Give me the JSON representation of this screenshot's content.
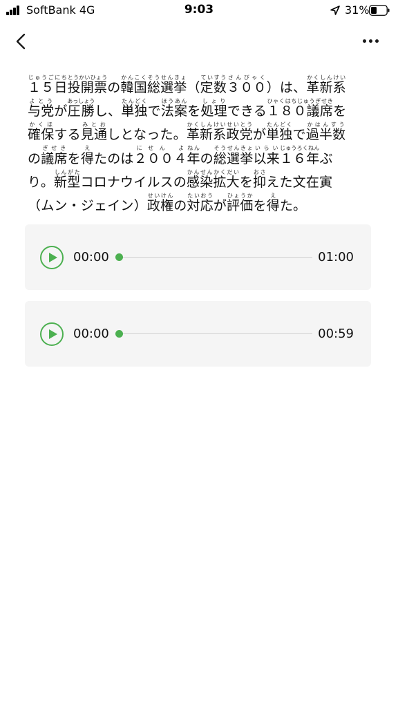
{
  "status_bar": {
    "carrier": "SoftBank  4G",
    "time": "9:03",
    "battery": "31%"
  },
  "nav": {
    "back_icon": "chevron-left-icon",
    "more_icon": "ellipsis-icon"
  },
  "article": {
    "lines": [
      [
        {
          "t": "１５日",
          "r": "じゅうごにち"
        },
        {
          "t": "投開票",
          "r": "とうかいひょう"
        },
        {
          "t": "の"
        },
        {
          "t": "韓国総選挙",
          "r": "かんこくそうせんきょ"
        },
        {
          "t": "（"
        },
        {
          "t": "定数",
          "r": "ていすう"
        },
        {
          "t": "３００",
          "r": "さんびゃく"
        },
        {
          "t": "）は、"
        },
        {
          "t": "革新系",
          "r": "かくしんけい"
        }
      ],
      [
        {
          "t": "与党",
          "r": "よとう"
        },
        {
          "t": "が"
        },
        {
          "t": "圧勝",
          "r": "あっしょう"
        },
        {
          "t": "し、"
        },
        {
          "t": "単独",
          "r": "たんどく"
        },
        {
          "t": "で"
        },
        {
          "t": "法案",
          "r": "ほうあん"
        },
        {
          "t": "を"
        },
        {
          "t": "処理",
          "r": "しょり"
        },
        {
          "t": "できる"
        },
        {
          "t": "１８０議席",
          "r": "ひゃくはちじゅうぎせき"
        },
        {
          "t": "を"
        }
      ],
      [
        {
          "t": "確保",
          "r": "かくほ"
        },
        {
          "t": "する"
        },
        {
          "t": "見通",
          "r": "みとお"
        },
        {
          "t": "しとなった。"
        },
        {
          "t": "革新系政党",
          "r": "かくしんけいせいとう"
        },
        {
          "t": "が"
        },
        {
          "t": "単独",
          "r": "たんどく"
        },
        {
          "t": "で"
        },
        {
          "t": "過半数",
          "r": "かはんすう"
        }
      ],
      [
        {
          "t": "の"
        },
        {
          "t": "議席",
          "r": "ぎせき"
        },
        {
          "t": "を"
        },
        {
          "t": "得",
          "r": "え"
        },
        {
          "t": "たのは"
        },
        {
          "t": "２００４",
          "r": "にせん よ"
        },
        {
          "t": "年",
          "r": "ねん"
        },
        {
          "t": "の"
        },
        {
          "t": "総選挙",
          "r": "そうせんきょ"
        },
        {
          "t": "以来",
          "r": "いらい"
        },
        {
          "t": "１６年",
          "r": "じゅうろくねん"
        },
        {
          "t": "ぶ"
        }
      ],
      [
        {
          "t": "り。"
        },
        {
          "t": "新型",
          "r": "しんがた"
        },
        {
          "t": "コロナウイルスの"
        },
        {
          "t": "感染拡大",
          "r": "かんせんかくだい"
        },
        {
          "t": "を"
        },
        {
          "t": "抑",
          "r": "おさ"
        },
        {
          "t": "えた"
        },
        {
          "t": "文在寅"
        }
      ],
      [
        {
          "t": "（ムン・ジェイン）"
        },
        {
          "t": "政権",
          "r": "せいけん"
        },
        {
          "t": "の"
        },
        {
          "t": "対応",
          "r": "たいおう"
        },
        {
          "t": "が"
        },
        {
          "t": "評価",
          "r": "ひょうか"
        },
        {
          "t": "を"
        },
        {
          "t": "得",
          "r": "え"
        },
        {
          "t": "た。"
        }
      ]
    ]
  },
  "audio": [
    {
      "current": "00:00",
      "total": "01:00",
      "progress": 0
    },
    {
      "current": "00:00",
      "total": "00:59",
      "progress": 0
    }
  ],
  "colors": {
    "accent": "#4cb050",
    "card_bg": "#f5f5f5"
  }
}
